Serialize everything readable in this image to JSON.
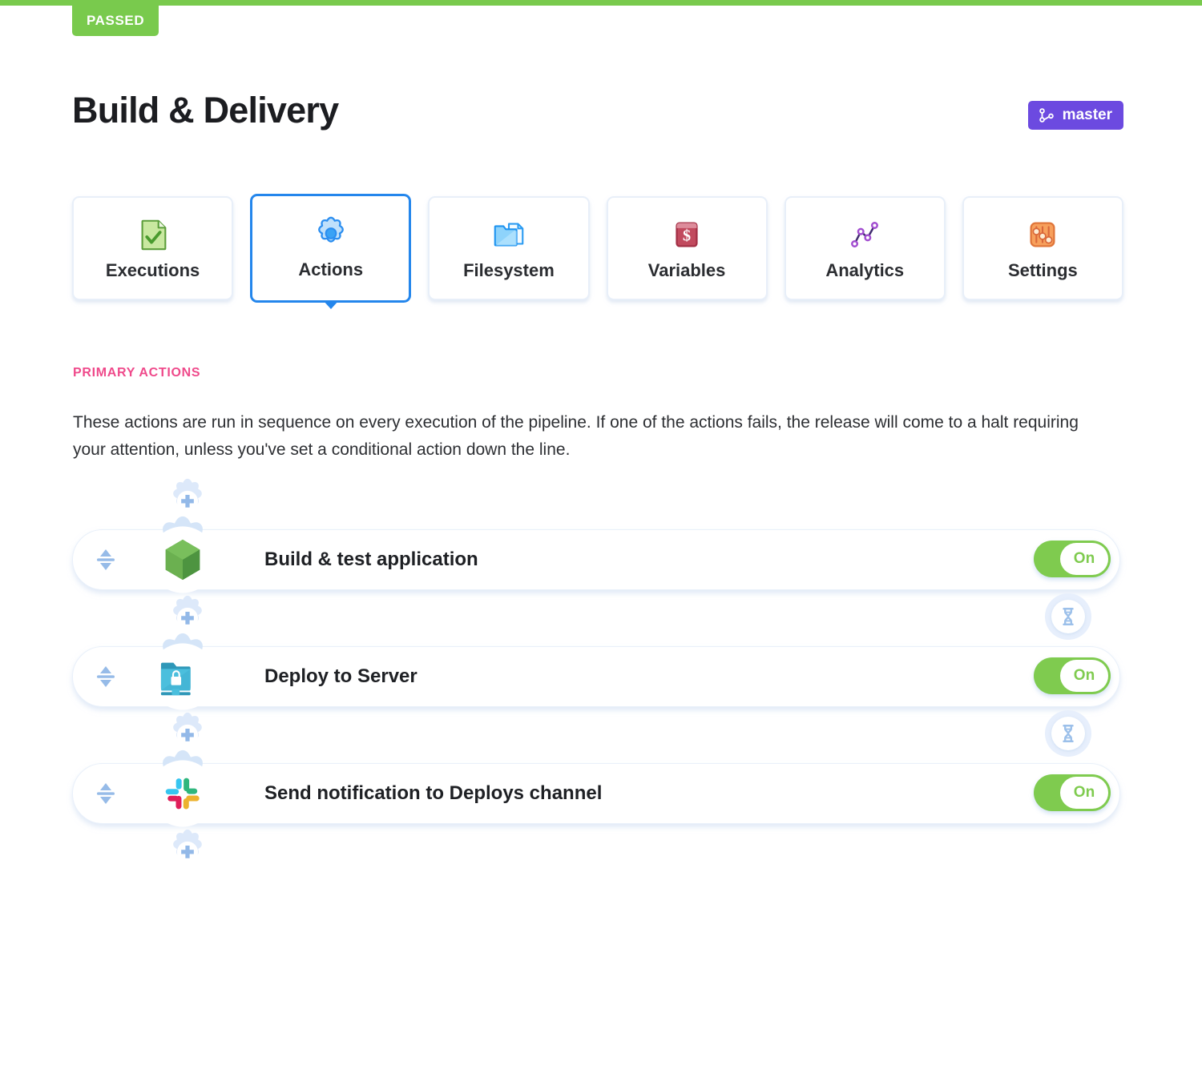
{
  "status": {
    "badge_label": "PASSED",
    "badge_color": "#79ca4d"
  },
  "header": {
    "title": "Build & Delivery",
    "branch": {
      "name": "master",
      "icon": "git-branch-icon",
      "color": "#6c4ae0"
    }
  },
  "tabs": [
    {
      "label": "Executions",
      "icon": "document-check-icon",
      "active": false
    },
    {
      "label": "Actions",
      "icon": "gear-icon",
      "active": true
    },
    {
      "label": "Filesystem",
      "icon": "folder-file-icon",
      "active": false
    },
    {
      "label": "Variables",
      "icon": "dollar-box-icon",
      "active": false
    },
    {
      "label": "Analytics",
      "icon": "line-chart-icon",
      "active": false
    },
    {
      "label": "Settings",
      "icon": "sliders-icon",
      "active": false
    }
  ],
  "section": {
    "label": "PRIMARY ACTIONS",
    "label_color": "#ef4a8b",
    "description": "These actions are run in sequence on every execution of the pipeline. If one of the actions fails, the release will come to a halt requiring your attention, unless you've set a conditional action down the line."
  },
  "pipeline": {
    "add_action_icon": "add-gear-icon",
    "wait_icon": "hourglass-icon",
    "drag_handle_icon": "drag-updown-icon",
    "actions": [
      {
        "title": "Build & test application",
        "icon": "nodejs-hexagon-icon",
        "toggle_label": "On",
        "toggle_on": true
      },
      {
        "title": "Deploy to Server",
        "icon": "sftp-folder-lock-icon",
        "toggle_label": "On",
        "toggle_on": true
      },
      {
        "title": "Send notification to Deploys channel",
        "icon": "slack-icon",
        "toggle_label": "On",
        "toggle_on": true
      }
    ]
  }
}
